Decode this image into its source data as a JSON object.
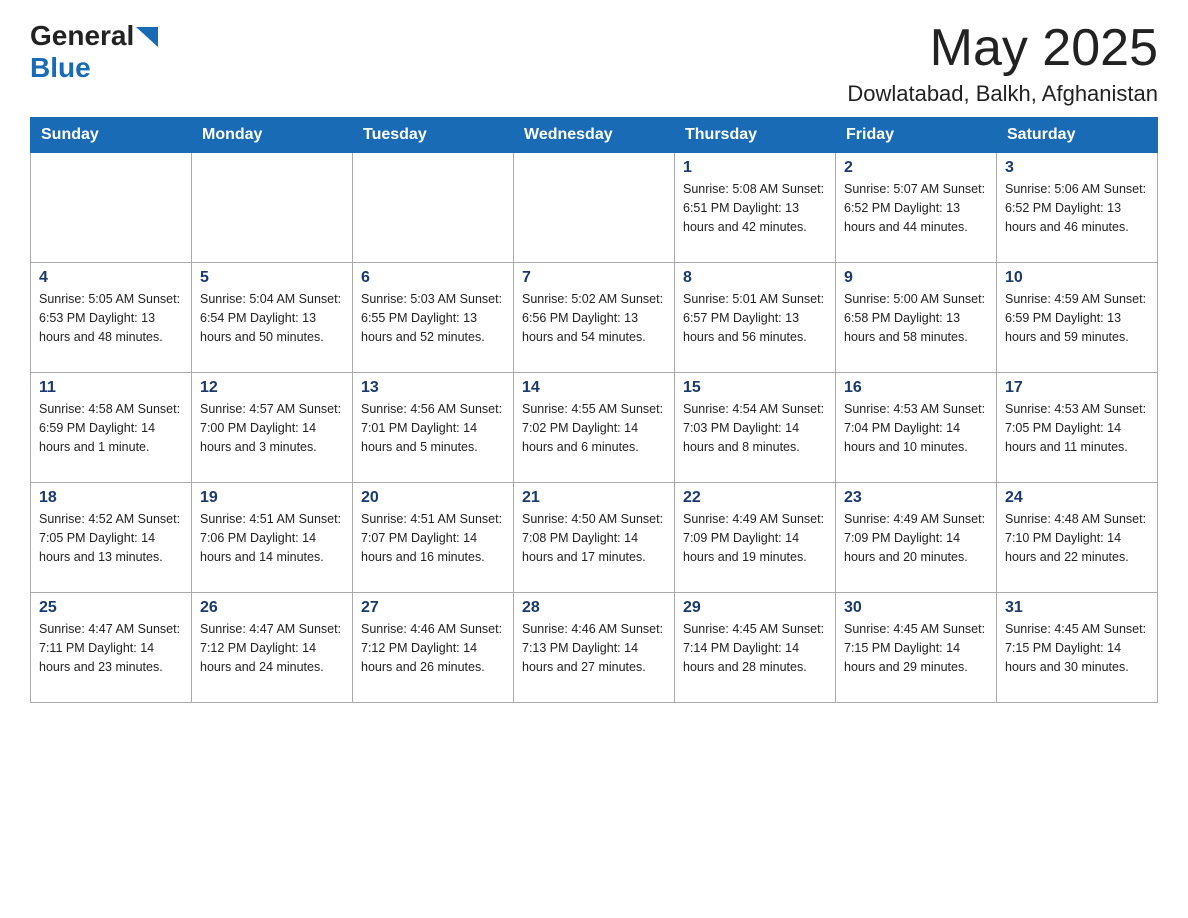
{
  "header": {
    "logo_general": "General",
    "logo_blue": "Blue",
    "month_year": "May 2025",
    "location": "Dowlatabad, Balkh, Afghanistan"
  },
  "days_of_week": [
    "Sunday",
    "Monday",
    "Tuesday",
    "Wednesday",
    "Thursday",
    "Friday",
    "Saturday"
  ],
  "weeks": [
    [
      {
        "day": "",
        "info": ""
      },
      {
        "day": "",
        "info": ""
      },
      {
        "day": "",
        "info": ""
      },
      {
        "day": "",
        "info": ""
      },
      {
        "day": "1",
        "info": "Sunrise: 5:08 AM\nSunset: 6:51 PM\nDaylight: 13 hours and 42 minutes."
      },
      {
        "day": "2",
        "info": "Sunrise: 5:07 AM\nSunset: 6:52 PM\nDaylight: 13 hours and 44 minutes."
      },
      {
        "day": "3",
        "info": "Sunrise: 5:06 AM\nSunset: 6:52 PM\nDaylight: 13 hours and 46 minutes."
      }
    ],
    [
      {
        "day": "4",
        "info": "Sunrise: 5:05 AM\nSunset: 6:53 PM\nDaylight: 13 hours and 48 minutes."
      },
      {
        "day": "5",
        "info": "Sunrise: 5:04 AM\nSunset: 6:54 PM\nDaylight: 13 hours and 50 minutes."
      },
      {
        "day": "6",
        "info": "Sunrise: 5:03 AM\nSunset: 6:55 PM\nDaylight: 13 hours and 52 minutes."
      },
      {
        "day": "7",
        "info": "Sunrise: 5:02 AM\nSunset: 6:56 PM\nDaylight: 13 hours and 54 minutes."
      },
      {
        "day": "8",
        "info": "Sunrise: 5:01 AM\nSunset: 6:57 PM\nDaylight: 13 hours and 56 minutes."
      },
      {
        "day": "9",
        "info": "Sunrise: 5:00 AM\nSunset: 6:58 PM\nDaylight: 13 hours and 58 minutes."
      },
      {
        "day": "10",
        "info": "Sunrise: 4:59 AM\nSunset: 6:59 PM\nDaylight: 13 hours and 59 minutes."
      }
    ],
    [
      {
        "day": "11",
        "info": "Sunrise: 4:58 AM\nSunset: 6:59 PM\nDaylight: 14 hours and 1 minute."
      },
      {
        "day": "12",
        "info": "Sunrise: 4:57 AM\nSunset: 7:00 PM\nDaylight: 14 hours and 3 minutes."
      },
      {
        "day": "13",
        "info": "Sunrise: 4:56 AM\nSunset: 7:01 PM\nDaylight: 14 hours and 5 minutes."
      },
      {
        "day": "14",
        "info": "Sunrise: 4:55 AM\nSunset: 7:02 PM\nDaylight: 14 hours and 6 minutes."
      },
      {
        "day": "15",
        "info": "Sunrise: 4:54 AM\nSunset: 7:03 PM\nDaylight: 14 hours and 8 minutes."
      },
      {
        "day": "16",
        "info": "Sunrise: 4:53 AM\nSunset: 7:04 PM\nDaylight: 14 hours and 10 minutes."
      },
      {
        "day": "17",
        "info": "Sunrise: 4:53 AM\nSunset: 7:05 PM\nDaylight: 14 hours and 11 minutes."
      }
    ],
    [
      {
        "day": "18",
        "info": "Sunrise: 4:52 AM\nSunset: 7:05 PM\nDaylight: 14 hours and 13 minutes."
      },
      {
        "day": "19",
        "info": "Sunrise: 4:51 AM\nSunset: 7:06 PM\nDaylight: 14 hours and 14 minutes."
      },
      {
        "day": "20",
        "info": "Sunrise: 4:51 AM\nSunset: 7:07 PM\nDaylight: 14 hours and 16 minutes."
      },
      {
        "day": "21",
        "info": "Sunrise: 4:50 AM\nSunset: 7:08 PM\nDaylight: 14 hours and 17 minutes."
      },
      {
        "day": "22",
        "info": "Sunrise: 4:49 AM\nSunset: 7:09 PM\nDaylight: 14 hours and 19 minutes."
      },
      {
        "day": "23",
        "info": "Sunrise: 4:49 AM\nSunset: 7:09 PM\nDaylight: 14 hours and 20 minutes."
      },
      {
        "day": "24",
        "info": "Sunrise: 4:48 AM\nSunset: 7:10 PM\nDaylight: 14 hours and 22 minutes."
      }
    ],
    [
      {
        "day": "25",
        "info": "Sunrise: 4:47 AM\nSunset: 7:11 PM\nDaylight: 14 hours and 23 minutes."
      },
      {
        "day": "26",
        "info": "Sunrise: 4:47 AM\nSunset: 7:12 PM\nDaylight: 14 hours and 24 minutes."
      },
      {
        "day": "27",
        "info": "Sunrise: 4:46 AM\nSunset: 7:12 PM\nDaylight: 14 hours and 26 minutes."
      },
      {
        "day": "28",
        "info": "Sunrise: 4:46 AM\nSunset: 7:13 PM\nDaylight: 14 hours and 27 minutes."
      },
      {
        "day": "29",
        "info": "Sunrise: 4:45 AM\nSunset: 7:14 PM\nDaylight: 14 hours and 28 minutes."
      },
      {
        "day": "30",
        "info": "Sunrise: 4:45 AM\nSunset: 7:15 PM\nDaylight: 14 hours and 29 minutes."
      },
      {
        "day": "31",
        "info": "Sunrise: 4:45 AM\nSunset: 7:15 PM\nDaylight: 14 hours and 30 minutes."
      }
    ]
  ]
}
